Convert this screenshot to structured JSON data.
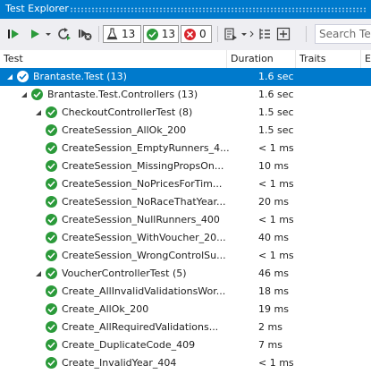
{
  "window": {
    "title": "Test Explorer"
  },
  "toolbar": {
    "passed_count": "13",
    "failed_count": "0",
    "total_count": "13",
    "search_placeholder": "Search Test"
  },
  "columns": {
    "test": "Test",
    "duration": "Duration",
    "traits": "Traits",
    "extra": "E"
  },
  "colors": {
    "accent": "#007acc",
    "passed": "#2b9a3a",
    "failed": "#d9262d"
  },
  "rows": [
    {
      "name": "Brantaste.Test (13)",
      "duration": "1.6 sec",
      "level": 0,
      "expanded": true,
      "selected": true
    },
    {
      "name": "Brantaste.Test.Controllers (13)",
      "duration": "1.6 sec",
      "level": 1,
      "expanded": true
    },
    {
      "name": "CheckoutControllerTest (8)",
      "duration": "1.5 sec",
      "level": 2,
      "expanded": true
    },
    {
      "name": "CreateSession_AllOk_200",
      "duration": "1.5 sec",
      "level": 3
    },
    {
      "name": "CreateSession_EmptyRunners_4...",
      "duration": "< 1 ms",
      "level": 3
    },
    {
      "name": "CreateSession_MissingPropsOn...",
      "duration": "10 ms",
      "level": 3
    },
    {
      "name": "CreateSession_NoPricesForTim...",
      "duration": "< 1 ms",
      "level": 3
    },
    {
      "name": "CreateSession_NoRaceThatYear...",
      "duration": "20 ms",
      "level": 3
    },
    {
      "name": "CreateSession_NullRunners_400",
      "duration": "< 1 ms",
      "level": 3
    },
    {
      "name": "CreateSession_WithVoucher_20...",
      "duration": "40 ms",
      "level": 3
    },
    {
      "name": "CreateSession_WrongControlSu...",
      "duration": "< 1 ms",
      "level": 3
    },
    {
      "name": "VoucherControllerTest (5)",
      "duration": "46 ms",
      "level": 2,
      "expanded": true
    },
    {
      "name": "Create_AllInvalidValidationsWor...",
      "duration": "18 ms",
      "level": 3
    },
    {
      "name": "Create_AllOk_200",
      "duration": "19 ms",
      "level": 3
    },
    {
      "name": "Create_AllRequiredValidations...",
      "duration": "2 ms",
      "level": 3
    },
    {
      "name": "Create_DuplicateCode_409",
      "duration": "7 ms",
      "level": 3
    },
    {
      "name": "Create_InvalidYear_404",
      "duration": "< 1 ms",
      "level": 3
    }
  ]
}
